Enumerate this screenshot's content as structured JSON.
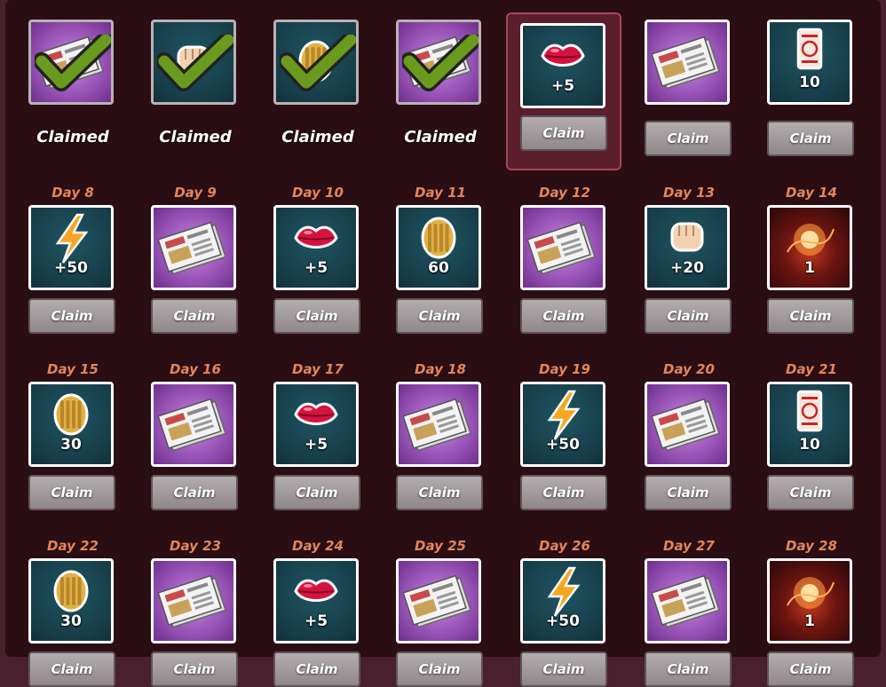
{
  "claim_label": "Claim",
  "claimed_label": "Claimed",
  "top_row": [
    {
      "status": "claimed",
      "bg": "purple",
      "icon": "newspaper-icon"
    },
    {
      "status": "claimed",
      "bg": "teal",
      "icon": "fist-icon"
    },
    {
      "status": "claimed",
      "bg": "teal",
      "icon": "coins-icon"
    },
    {
      "status": "claimed",
      "bg": "purple",
      "icon": "newspaper-icon"
    },
    {
      "status": "current",
      "bg": "teal",
      "icon": "kiss-icon",
      "amount": "+5"
    },
    {
      "status": "available",
      "bg": "purple",
      "icon": "newspaper-icon"
    },
    {
      "status": "available",
      "bg": "teal",
      "icon": "ticket-icon",
      "amount": "10"
    }
  ],
  "rows": [
    [
      {
        "day": "Day 8",
        "bg": "teal",
        "icon": "lightning-icon",
        "amount": "+50"
      },
      {
        "day": "Day 9",
        "bg": "purple",
        "icon": "newspaper-icon",
        "amount": ""
      },
      {
        "day": "Day 10",
        "bg": "teal",
        "icon": "kiss-icon",
        "amount": "+5"
      },
      {
        "day": "Day 11",
        "bg": "teal",
        "icon": "coins-icon",
        "amount": "60"
      },
      {
        "day": "Day 12",
        "bg": "purple",
        "icon": "newspaper-icon",
        "amount": ""
      },
      {
        "day": "Day 13",
        "bg": "teal",
        "icon": "fist-icon",
        "amount": "+20"
      },
      {
        "day": "Day 14",
        "bg": "magic",
        "icon": "magic-orb-icon",
        "amount": "1"
      }
    ],
    [
      {
        "day": "Day 15",
        "bg": "teal",
        "icon": "coins-icon",
        "amount": "30"
      },
      {
        "day": "Day 16",
        "bg": "purple",
        "icon": "newspaper-icon",
        "amount": ""
      },
      {
        "day": "Day 17",
        "bg": "teal",
        "icon": "kiss-icon",
        "amount": "+5"
      },
      {
        "day": "Day 18",
        "bg": "purple",
        "icon": "newspaper-icon",
        "amount": ""
      },
      {
        "day": "Day 19",
        "bg": "teal",
        "icon": "lightning-icon",
        "amount": "+50"
      },
      {
        "day": "Day 20",
        "bg": "purple",
        "icon": "newspaper-icon",
        "amount": ""
      },
      {
        "day": "Day 21",
        "bg": "teal",
        "icon": "ticket-icon",
        "amount": "10"
      }
    ],
    [
      {
        "day": "Day 22",
        "bg": "teal",
        "icon": "coins-icon",
        "amount": "30"
      },
      {
        "day": "Day 23",
        "bg": "purple",
        "icon": "newspaper-icon",
        "amount": ""
      },
      {
        "day": "Day 24",
        "bg": "teal",
        "icon": "kiss-icon",
        "amount": "+5"
      },
      {
        "day": "Day 25",
        "bg": "purple",
        "icon": "newspaper-icon",
        "amount": ""
      },
      {
        "day": "Day 26",
        "bg": "teal",
        "icon": "lightning-icon",
        "amount": "+50"
      },
      {
        "day": "Day 27",
        "bg": "purple",
        "icon": "newspaper-icon",
        "amount": ""
      },
      {
        "day": "Day 28",
        "bg": "magic",
        "icon": "magic-orb-icon",
        "amount": "1"
      }
    ]
  ],
  "colors": {
    "day_label": "#e2865a",
    "tile_teal": "#173e4a",
    "tile_purple": "#9a55b8",
    "claim_button": "#a39b9d",
    "check_green": "#6a9a1e",
    "kiss_red": "#d6123e",
    "lightning_orange": "#f5a623"
  }
}
